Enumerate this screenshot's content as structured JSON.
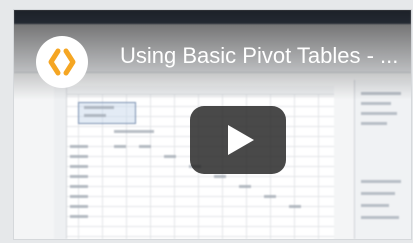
{
  "video": {
    "title": "Using Basic Pivot Tables - ...",
    "play_label": "Play"
  },
  "icons": {
    "channel_logo": "curly-braces-logo-icon",
    "play": "play-icon"
  },
  "colors": {
    "logo_orange": "#f5a623",
    "play_bg": "#212121",
    "title_text": "#ffffff"
  }
}
